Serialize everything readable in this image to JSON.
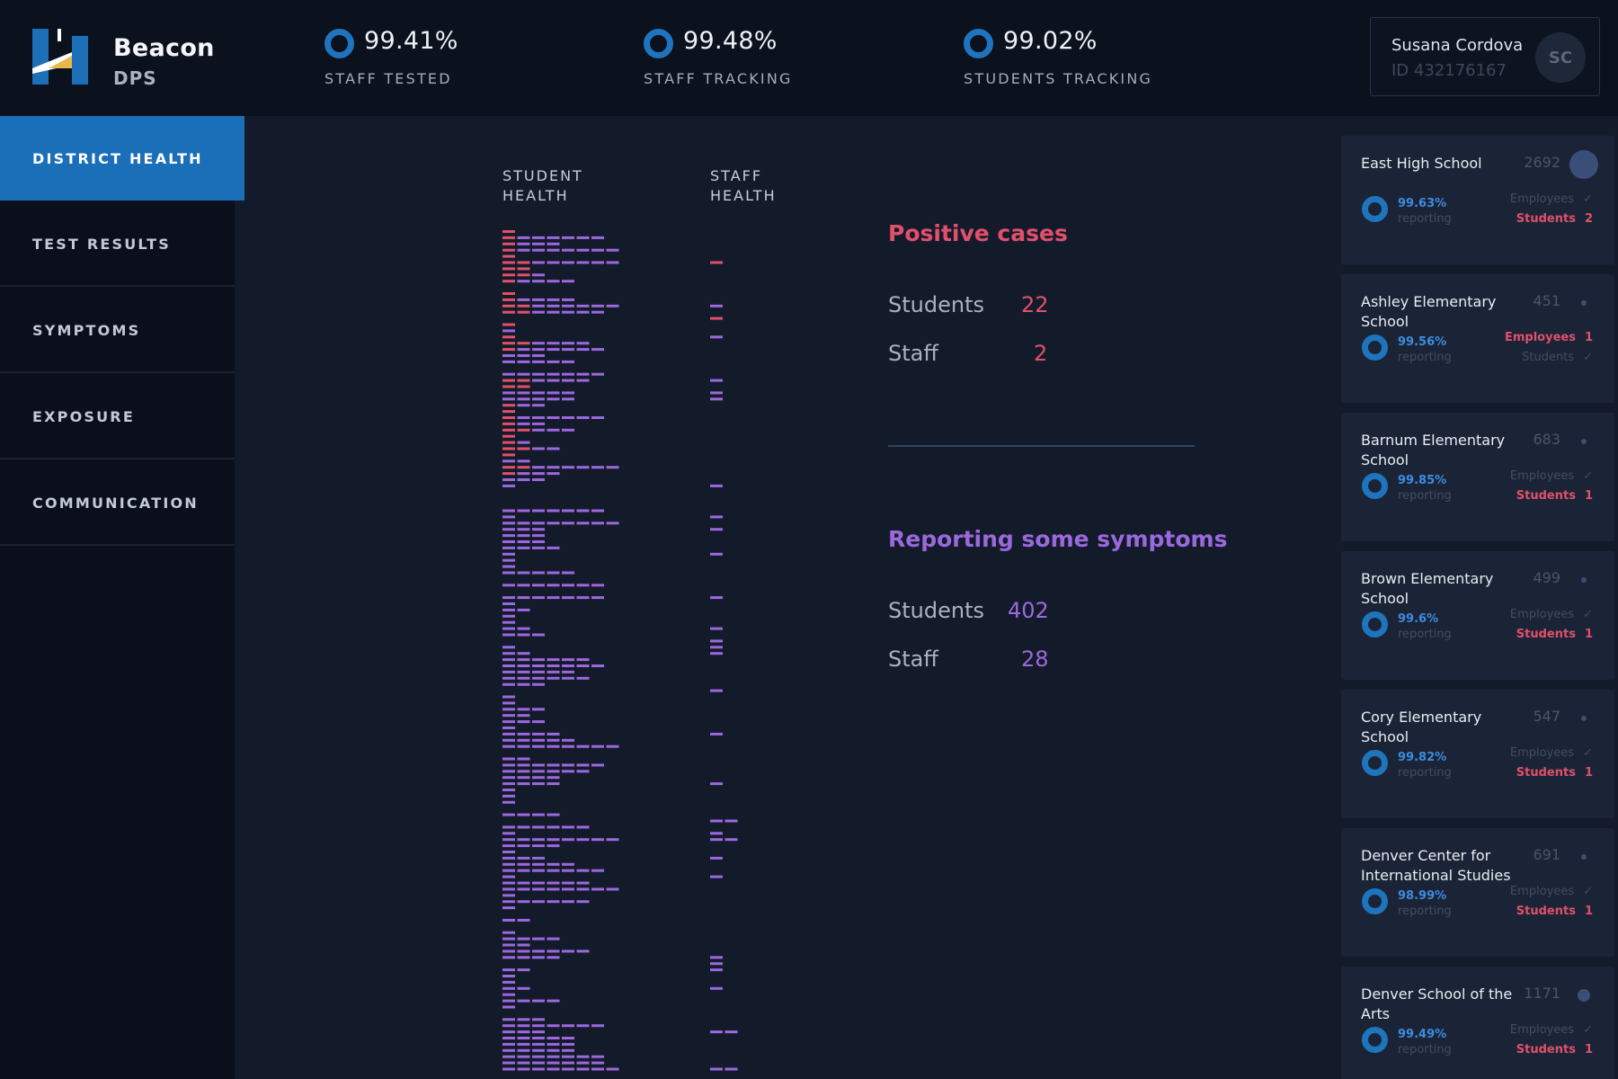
{
  "brand": {
    "name": "Beacon",
    "sub": "DPS"
  },
  "stats": [
    {
      "value": "99.41%",
      "label": "STAFF TESTED"
    },
    {
      "value": "99.48%",
      "label": "STAFF TRACKING"
    },
    {
      "value": "99.02%",
      "label": "STUDENTS TRACKING"
    }
  ],
  "user": {
    "name": "Susana Cordova",
    "id": "ID 432176167",
    "initials": "SC"
  },
  "nav": [
    {
      "label": "DISTRICT HEALTH",
      "active": true
    },
    {
      "label": "TEST RESULTS",
      "active": false
    },
    {
      "label": "SYMPTOMS",
      "active": false
    },
    {
      "label": "EXPOSURE",
      "active": false
    },
    {
      "label": "COMMUNICATION",
      "active": false
    }
  ],
  "columns": {
    "student": "STUDENT\nHEALTH",
    "staff": "STAFF\nHEALTH"
  },
  "positive": {
    "title": "Positive cases",
    "students_label": "Students",
    "students": "22",
    "staff_label": "Staff",
    "staff": "2"
  },
  "symptoms": {
    "title": "Reporting some symptoms",
    "students_label": "Students",
    "students": "402",
    "staff_label": "Staff",
    "staff": "28"
  },
  "colors": {
    "accent": "#1b6fb8",
    "positive": "#e0506a",
    "symptom": "#9c68dd"
  },
  "schools": [
    {
      "name": "East High School",
      "count": "2692",
      "pct": "99.63%",
      "reporting": "reporting",
      "employees": "Employees",
      "employees_status": "✓",
      "employees_alert": false,
      "students": "Students",
      "students_status": "2",
      "students_alert": true,
      "dot": "large"
    },
    {
      "name": "Ashley Elementary School",
      "count": "451",
      "pct": "99.56%",
      "reporting": "reporting",
      "employees": "Employees",
      "employees_status": "1",
      "employees_alert": true,
      "students": "Students",
      "students_status": "✓",
      "students_alert": false,
      "dot": "small"
    },
    {
      "name": "Barnum Elementary School",
      "count": "683",
      "pct": "99.85%",
      "reporting": "reporting",
      "employees": "Employees",
      "employees_status": "✓",
      "employees_alert": false,
      "students": "Students",
      "students_status": "1",
      "students_alert": true,
      "dot": "small"
    },
    {
      "name": "Brown Elementary School",
      "count": "499",
      "pct": "99.6%",
      "reporting": "reporting",
      "employees": "Employees",
      "employees_status": "✓",
      "employees_alert": false,
      "students": "Students",
      "students_status": "1",
      "students_alert": true,
      "dot": "small"
    },
    {
      "name": "Cory Elementary School",
      "count": "547",
      "pct": "99.82%",
      "reporting": "reporting",
      "employees": "Employees",
      "employees_status": "✓",
      "employees_alert": false,
      "students": "Students",
      "students_status": "1",
      "students_alert": true,
      "dot": "small"
    },
    {
      "name": "Denver Center for International Studies",
      "count": "691",
      "pct": "98.99%",
      "reporting": "reporting",
      "employees": "Employees",
      "employees_status": "✓",
      "employees_alert": false,
      "students": "Students",
      "students_status": "1",
      "students_alert": true,
      "dot": "small"
    },
    {
      "name": "Denver School of the Arts",
      "count": "1171",
      "pct": "99.49%",
      "reporting": "reporting",
      "employees": "Employees",
      "employees_status": "✓",
      "employees_alert": false,
      "students": "Students",
      "students_status": "1",
      "students_alert": true,
      "dot": "medium"
    }
  ]
}
